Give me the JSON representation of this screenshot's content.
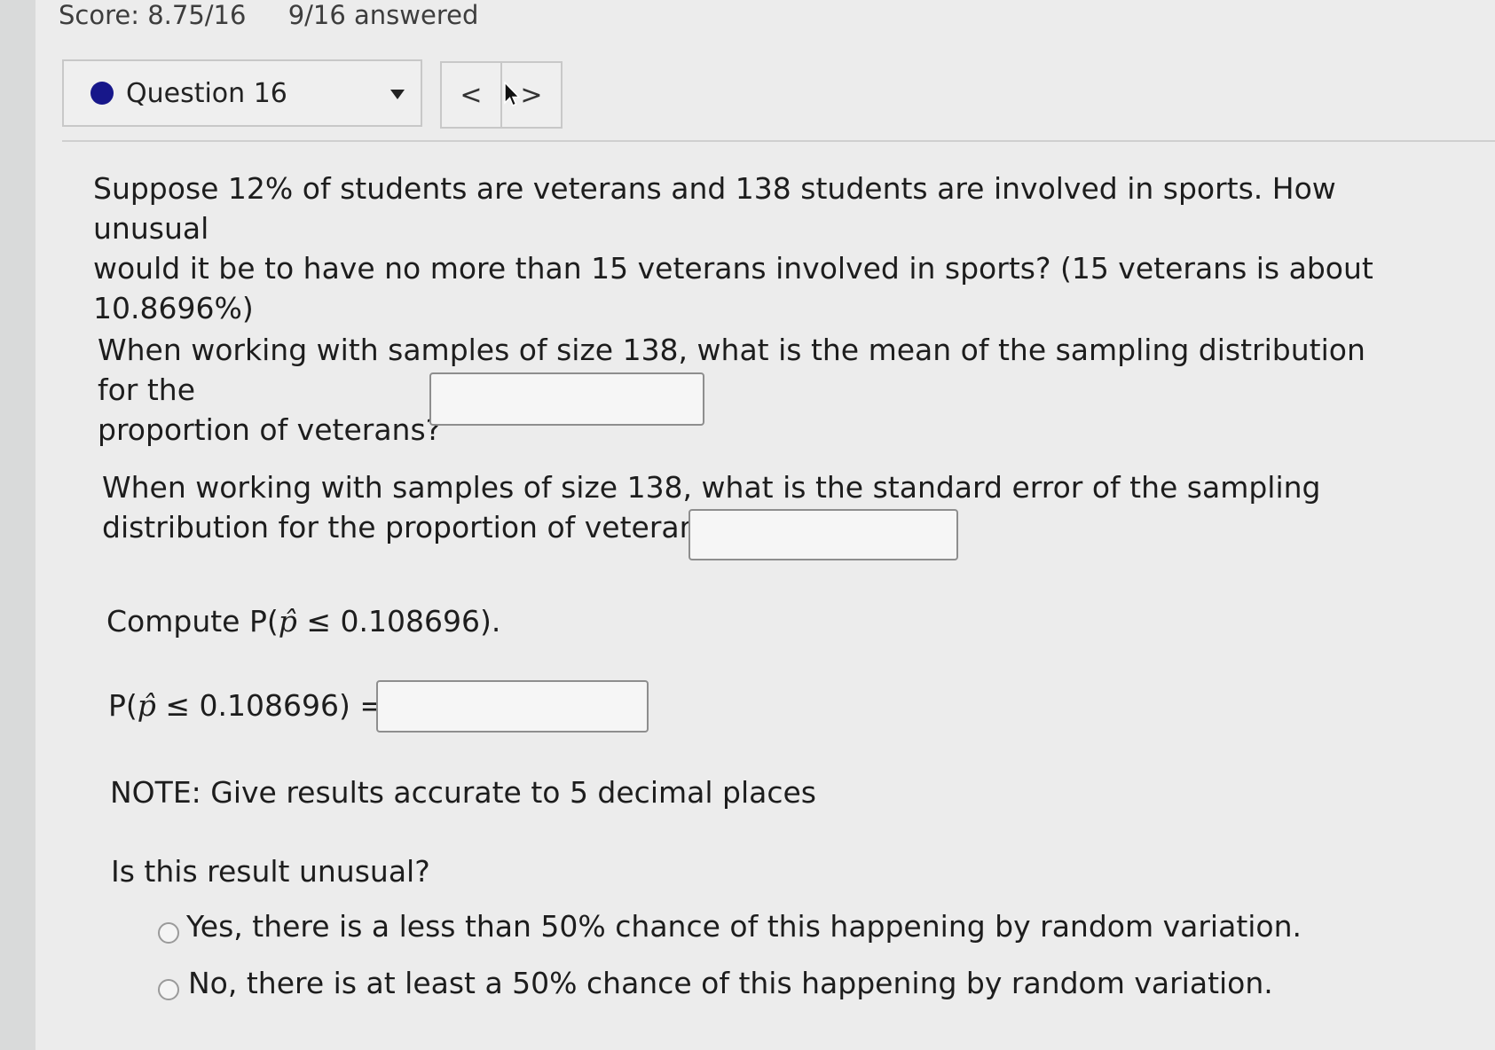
{
  "header": {
    "score": "Score: 8.75/16",
    "answered": "9/16 answered"
  },
  "question_nav": {
    "selected_label": "Question 16",
    "prev_label": "<",
    "next_label": ">"
  },
  "question": {
    "prompt_line1": "Suppose 12% of students are veterans and 138 students are involved in sports. How unusual",
    "prompt_line2": "would it be to have no more than 15 veterans involved in sports? (15 veterans is about",
    "prompt_line3": "10.8696%)",
    "mean_line1": "When working with samples of size 138, what is the mean of the sampling distribution for the",
    "mean_line2": "proportion of veterans?",
    "se_line1": "When working with samples of size 138, what is the standard error of the sampling",
    "se_line2": "distribution for the proportion of veterans?",
    "compute_prefix": "Compute P(",
    "compute_suffix": " 0.108696).",
    "prob_prefix": "P(",
    "prob_suffix": " 0.108696) =",
    "p_hat": "p̂",
    "leq": "≤",
    "note": "NOTE: Give results accurate to 5 decimal places",
    "unusual_question": "Is this result unusual?"
  },
  "answers": {
    "mean_value": "",
    "se_value": "",
    "prob_value": ""
  },
  "options": [
    {
      "label": "Yes, there is a less than 50% chance of this happening by random variation.",
      "selected": false
    },
    {
      "label": "No, there is at least a 50% chance of this happening by random variation.",
      "selected": false
    }
  ],
  "colors": {
    "status_dot": "#17178a",
    "background": "#ececec"
  }
}
